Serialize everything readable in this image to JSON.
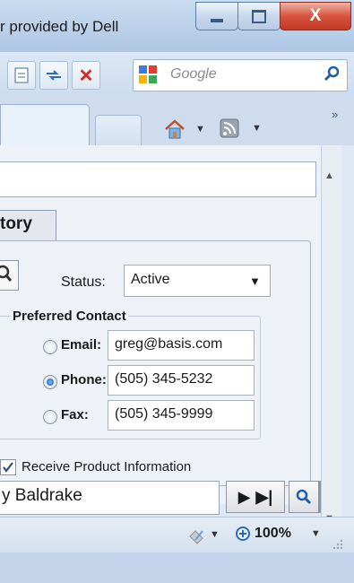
{
  "window": {
    "title": "r provided by Dell",
    "controls": {
      "minimize": "–",
      "maximize": "□",
      "close": "X"
    }
  },
  "toolbar": {
    "buttons": [
      {
        "name": "compat-view-icon",
        "glyph": "⊡"
      },
      {
        "name": "refresh-icon",
        "glyph": "↹"
      },
      {
        "name": "stop-icon",
        "glyph": "✕"
      }
    ],
    "search": {
      "placeholder": "Google",
      "go_icon": "search-icon"
    }
  },
  "tabs": {
    "overflow": "»"
  },
  "command_bar": {
    "home_icon": "home-icon",
    "feeds_icon": "feeds-icon"
  },
  "form": {
    "tab_label": "tory",
    "status_label": "Status:",
    "status_value": "Active",
    "preferred_contact": {
      "legend": "Preferred Contact",
      "options": [
        {
          "label": "Email:",
          "value": "greg@basis.com",
          "selected": false
        },
        {
          "label": "Phone:",
          "value": "(505) 345-5232",
          "selected": true
        },
        {
          "label": "Fax:",
          "value": "(505) 345-9999",
          "selected": false
        }
      ]
    },
    "receive_info": {
      "label": "Receive Product Information",
      "checked": true
    },
    "name_value": "y Baldrake"
  },
  "statusbar": {
    "zoom": "100%"
  }
}
